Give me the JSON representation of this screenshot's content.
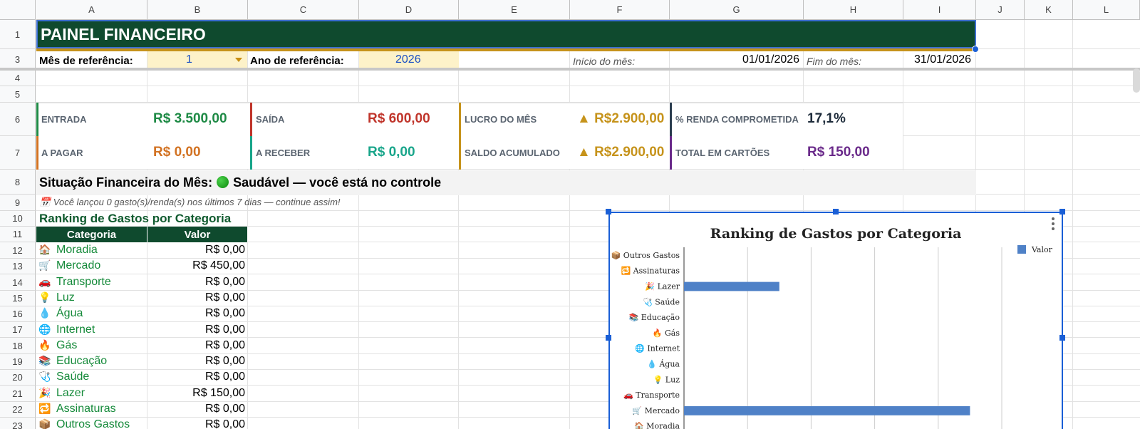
{
  "columns": [
    "A",
    "B",
    "C",
    "D",
    "E",
    "F",
    "G",
    "H",
    "I",
    "J",
    "K",
    "L"
  ],
  "rows": [
    "1",
    "3",
    "4",
    "5",
    "6",
    "7",
    "8",
    "9",
    "10",
    "11",
    "12",
    "13",
    "14",
    "15",
    "16",
    "17",
    "18",
    "19",
    "20",
    "21",
    "22",
    "23"
  ],
  "title": "PAINEL FINANCEIRO",
  "reference": {
    "month_label": "Mês de referência:",
    "month_value": "1",
    "year_label": "Ano de referência:",
    "year_value": "2026",
    "start_label": "Início do mês:",
    "start_value": "01/01/2026",
    "end_label": "Fim do mês:",
    "end_value": "31/01/2026"
  },
  "kpis": [
    {
      "label": "ENTRADA",
      "value": "R$ 3.500,00",
      "color": "#1e8a45",
      "strip": "#1e8a45"
    },
    {
      "label": "SAÍDA",
      "value": "R$ 600,00",
      "color": "#c0352b",
      "strip": "#c0352b"
    },
    {
      "label": "LUCRO DO MÊS",
      "value": "▲ R$2.900,00",
      "color": "#c6931b",
      "strip": "#c6931b"
    },
    {
      "label": "% RENDA COMPROMETIDA",
      "value": "17,1%",
      "color": "#1d2b3a",
      "strip": "#2c3e50"
    },
    {
      "label": "A PAGAR",
      "value": "R$ 0,00",
      "color": "#d27222",
      "strip": "#d27222"
    },
    {
      "label": "A RECEBER",
      "value": "R$ 0,00",
      "color": "#18a58a",
      "strip": "#18a58a"
    },
    {
      "label": "SALDO ACUMULADO",
      "value": "▲ R$2.900,00",
      "color": "#c6931b",
      "strip": "#c6931b"
    },
    {
      "label": "TOTAL EM CARTÕES",
      "value": "R$ 150,00",
      "color": "#6a2a8a",
      "strip": "#6a2a8a"
    }
  ],
  "status": {
    "label": "Situação Financeira do Mês:",
    "value": "Saudável — você está no controle"
  },
  "note": "📅 Você lançou 0 gasto(s)/renda(s) nos últimos 7 dias — continue assim!",
  "ranking": {
    "title": "Ranking de Gastos por Categoria",
    "header_category": "Categoria",
    "header_value": "Valor",
    "rows": [
      {
        "icon": "🏠",
        "category": "Moradia",
        "value": "R$ 0,00"
      },
      {
        "icon": "🛒",
        "category": "Mercado",
        "value": "R$ 450,00"
      },
      {
        "icon": "🚗",
        "category": "Transporte",
        "value": "R$ 0,00"
      },
      {
        "icon": "💡",
        "category": "Luz",
        "value": "R$ 0,00"
      },
      {
        "icon": "💧",
        "category": "Água",
        "value": "R$ 0,00"
      },
      {
        "icon": "🌐",
        "category": "Internet",
        "value": "R$ 0,00"
      },
      {
        "icon": "🔥",
        "category": "Gás",
        "value": "R$ 0,00"
      },
      {
        "icon": "📚",
        "category": "Educação",
        "value": "R$ 0,00"
      },
      {
        "icon": "🩺",
        "category": "Saúde",
        "value": "R$ 0,00"
      },
      {
        "icon": "🎉",
        "category": "Lazer",
        "value": "R$ 150,00"
      },
      {
        "icon": "🔁",
        "category": "Assinaturas",
        "value": "R$ 0,00"
      },
      {
        "icon": "📦",
        "category": "Outros Gastos",
        "value": "R$ 0,00"
      }
    ]
  },
  "chart_data": {
    "type": "bar",
    "orientation": "horizontal",
    "title": "Ranking de Gastos por Categoria",
    "legend": "Valor",
    "legend_position": "top-right",
    "bar_color": "#4f81c7",
    "categories": [
      "📦 Outros Gastos",
      "🔁 Assinaturas",
      "🎉 Lazer",
      "🩺 Saúde",
      "📚 Educação",
      "🔥 Gás",
      "🌐 Internet",
      "💧 Água",
      "💡 Luz",
      "🚗 Transporte",
      "🛒 Mercado",
      "🏠 Moradia"
    ],
    "series": [
      {
        "name": "Valor",
        "values": [
          0,
          0,
          150,
          0,
          0,
          0,
          0,
          0,
          0,
          0,
          450,
          0
        ]
      }
    ],
    "xlim": [
      0,
      500
    ],
    "grid": true
  }
}
